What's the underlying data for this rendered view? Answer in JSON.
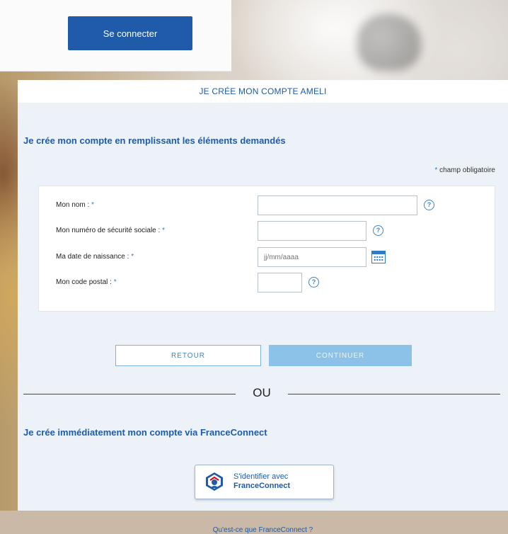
{
  "login": {
    "button_label": "Se connecter"
  },
  "panel": {
    "header": "JE CRÉE MON COMPTE AMELI"
  },
  "form": {
    "title": "Je crée mon compte en remplissant les éléments demandés",
    "required_star": "*",
    "required_note": "champ obligatoire",
    "fields": [
      {
        "label": "Mon nom :",
        "value": "",
        "placeholder": ""
      },
      {
        "label": "Mon numéro de sécurité sociale :",
        "value": "",
        "placeholder": ""
      },
      {
        "label": "Ma date de naissance :",
        "value": "",
        "placeholder": "jj/mm/aaaa"
      },
      {
        "label": "Mon code postal :",
        "value": "",
        "placeholder": ""
      }
    ],
    "help_glyph": "?",
    "back_label": "RETOUR",
    "continue_label": "CONTINUER"
  },
  "separator": "OU",
  "franceconnect": {
    "title": "Je crée immédiatement mon compte via FranceConnect",
    "button_line1": "S'identifier avec",
    "button_line2": "FranceConnect",
    "link": "Qu'est-ce que FranceConnect ?"
  },
  "colors": {
    "brand_blue": "#1f5ba8",
    "accent_blue": "#3d86c9",
    "disabled_button": "#8cc2e8",
    "form_background": "#ecf2f8"
  }
}
